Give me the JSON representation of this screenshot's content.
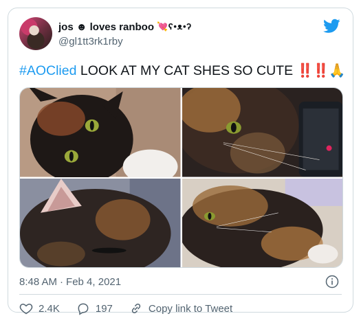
{
  "user": {
    "display_name": "jos",
    "name_suffix": "☻ loves ranboo",
    "name_emoji": "💘ʕ•ᴥ•ʔ",
    "handle": "@gl1tt3rk1rby"
  },
  "tweet": {
    "hashtag": "#AOClied",
    "text": "LOOK AT MY CAT SHES SO CUTE",
    "emphasis_1": "‼️",
    "emphasis_2": "‼️",
    "emoji": "🙏"
  },
  "photos": [
    {
      "alt": "cat-photo-1"
    },
    {
      "alt": "cat-photo-2"
    },
    {
      "alt": "cat-photo-3"
    },
    {
      "alt": "cat-photo-4"
    }
  ],
  "meta": {
    "time": "8:48 AM",
    "separator": "·",
    "date": "Feb 4, 2021"
  },
  "actions": {
    "likes": "2.4K",
    "replies": "197",
    "copy_link": "Copy link to Tweet"
  },
  "colors": {
    "accent": "#1d9bf0",
    "text_secondary": "#536471",
    "like_heart": "#e0245e"
  }
}
